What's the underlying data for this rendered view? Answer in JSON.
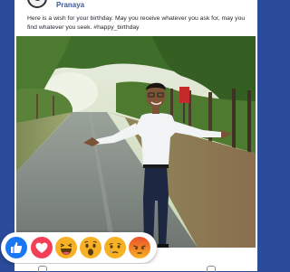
{
  "post": {
    "author": "Pranaya",
    "caption": "Here is a wish for your birthday. May you receive whatever you ask for, may you find whatever you seek. #happy_birthday"
  },
  "reactions": [
    {
      "name": "like",
      "color": "#1877f2"
    },
    {
      "name": "love",
      "color": "#f33e58"
    },
    {
      "name": "haha",
      "color": "#f7b125"
    },
    {
      "name": "wow",
      "color": "#f7b125"
    },
    {
      "name": "sad",
      "color": "#f7b125"
    },
    {
      "name": "angry",
      "color": "#e9710f"
    }
  ],
  "colors": {
    "background": "#2b4b9b",
    "author": "#3b5998"
  }
}
